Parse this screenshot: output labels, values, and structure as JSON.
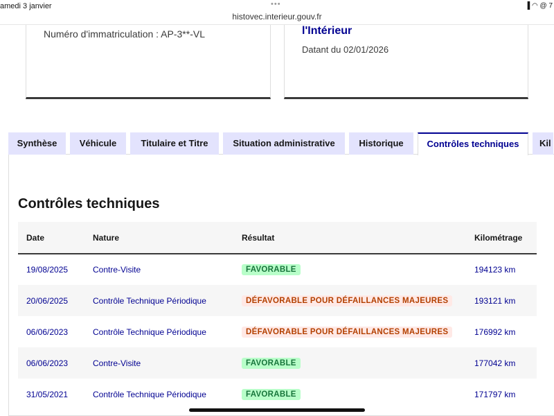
{
  "status": {
    "time": "amedi 3 janvier",
    "url": "histovec.interieur.gouv.fr",
    "icons": "▐ ◠ @ 7"
  },
  "card_left": {
    "text": "Numéro d'immatriculation : AP-3**-VL"
  },
  "card_right": {
    "title": "l'Intérieur",
    "date": "Datant du 02/01/2026"
  },
  "tabs": [
    {
      "label": "Synthèse"
    },
    {
      "label": "Véhicule"
    },
    {
      "label": "Titulaire et Titre"
    },
    {
      "label": "Situation administrative"
    },
    {
      "label": "Historique"
    },
    {
      "label": "Contrôles techniques"
    },
    {
      "label": "Kil"
    }
  ],
  "section_title": "Contrôles techniques",
  "table": {
    "headers": [
      "Date",
      "Nature",
      "Résultat",
      "Kilométrage"
    ],
    "rows": [
      {
        "date": "19/08/2025",
        "nature": "Contre-Visite",
        "result": "FAVORABLE",
        "km": "194123 km"
      },
      {
        "date": "20/06/2025",
        "nature": "Contrôle Technique Périodique",
        "result": "DÉFAVORABLE POUR DÉFAILLANCES MAJEURES",
        "km": "193121 km"
      },
      {
        "date": "06/06/2023",
        "nature": "Contrôle Technique Périodique",
        "result": "DÉFAVORABLE POUR DÉFAILLANCES MAJEURES",
        "km": "176992 km"
      },
      {
        "date": "06/06/2023",
        "nature": "Contre-Visite",
        "result": "FAVORABLE",
        "km": "177042 km"
      },
      {
        "date": "31/05/2021",
        "nature": "Contrôle Technique Périodique",
        "result": "FAVORABLE",
        "km": "171797 km"
      }
    ]
  },
  "colors": {
    "accent": "#000091",
    "favorable": "#18753c",
    "defavorable": "#b34000"
  }
}
